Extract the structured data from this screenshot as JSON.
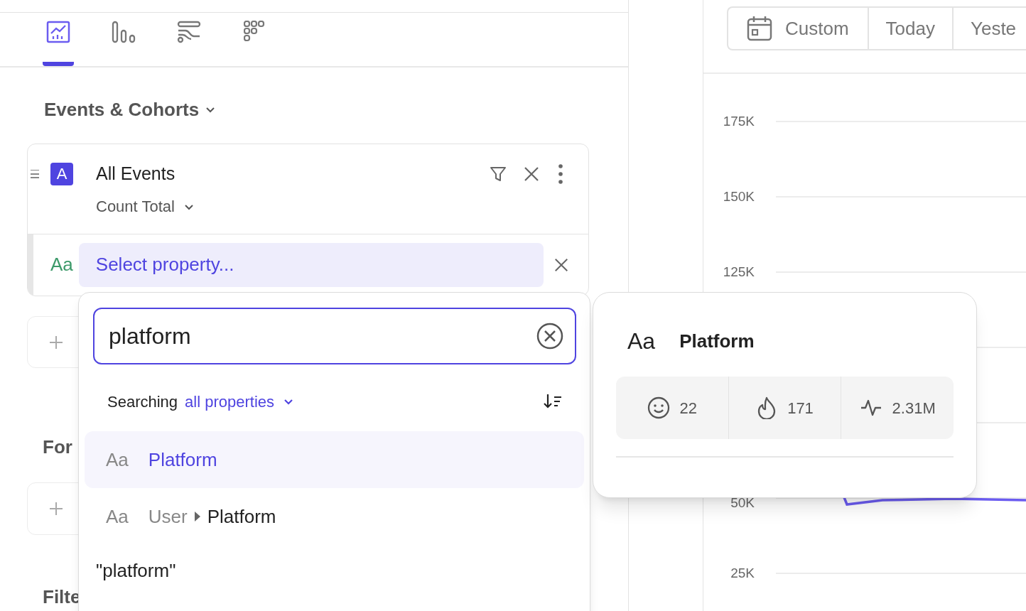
{
  "tabs": [
    {
      "kind": "line",
      "selected": true
    },
    {
      "kind": "bars",
      "selected": false
    },
    {
      "kind": "flows",
      "selected": false
    },
    {
      "kind": "grid",
      "selected": false
    }
  ],
  "events_section": {
    "title": "Events & Cohorts",
    "metric": {
      "badge": "A",
      "name": "All Events",
      "aggregation": "Count Total"
    },
    "breakdown": {
      "type_label": "Aa",
      "label": "Select property..."
    }
  },
  "sections": [
    {
      "title": "For"
    },
    {
      "title": "Filte"
    }
  ],
  "property_search": {
    "value": "platform",
    "scope_label": "Searching",
    "scope": "all properties",
    "results": [
      {
        "kind": "property",
        "type_label": "Aa",
        "name": "Platform",
        "selected": true
      },
      {
        "kind": "nested",
        "type_label": "Aa",
        "parent": "User",
        "name": "Platform",
        "selected": false
      },
      {
        "kind": "literal",
        "name": "\"platform\"",
        "selected": false
      }
    ]
  },
  "property_details": {
    "type_label": "Aa",
    "name": "Platform",
    "stats": [
      {
        "kind": "smile",
        "value": "22"
      },
      {
        "kind": "flame",
        "value": "171"
      },
      {
        "kind": "pulse",
        "value": "2.31M"
      }
    ]
  },
  "date_range": [
    {
      "kind": "calendar",
      "label": "Custom"
    },
    {
      "kind": "plain",
      "label": "Today"
    },
    {
      "kind": "plain",
      "label": "Yeste"
    }
  ],
  "chart": {
    "upper_axis_labels": [
      "175K",
      "150K",
      "125K"
    ],
    "lower_axis_labels": [
      "50K",
      "25K"
    ]
  }
}
